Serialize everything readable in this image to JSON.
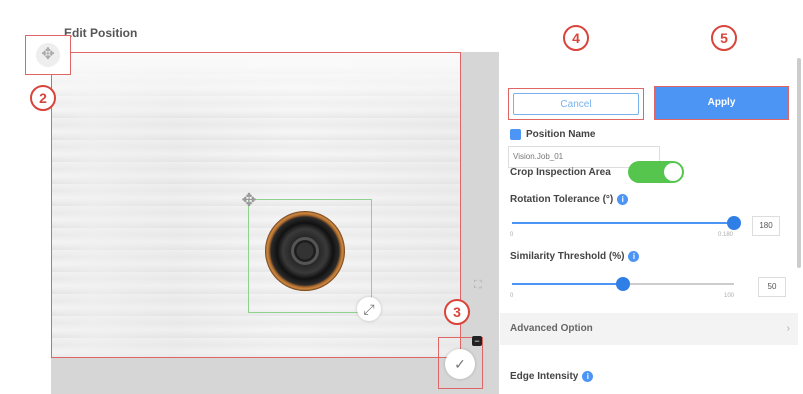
{
  "header": {
    "title": "Edit Position"
  },
  "badges": {
    "b2": "2",
    "b3": "3",
    "b4": "4",
    "b5": "5"
  },
  "icons": {
    "move": "move-icon",
    "resize": "resize-icon",
    "confirm": "check-icon",
    "fit": "fit-screen-icon"
  },
  "glyphs": {
    "move": "✥",
    "resize": "⤢",
    "check": "✓",
    "minus": "−",
    "fit": "⛶",
    "chev": "›"
  },
  "actions": {
    "cancel_label": "Cancel",
    "apply_label": "Apply"
  },
  "position_name": {
    "label": "Position Name",
    "value": "Vision.Job_01"
  },
  "crop": {
    "label": "Crop Inspection Area",
    "enabled": true
  },
  "rotation": {
    "label": "Rotation Tolerance (°)",
    "min": "0",
    "max": "0.180",
    "value": "180",
    "level": 1.0
  },
  "similarity": {
    "label": "Similarity Threshold (%)",
    "min": "0",
    "max": "100",
    "value": "50",
    "level": 0.5
  },
  "advanced": {
    "label": "Advanced Option"
  },
  "edge": {
    "label": "Edge Intensity"
  },
  "colors": {
    "accent": "#4c95f5",
    "toggle_on": "#55c54e",
    "highlight": "#e06666",
    "badge": "#d9443a"
  }
}
